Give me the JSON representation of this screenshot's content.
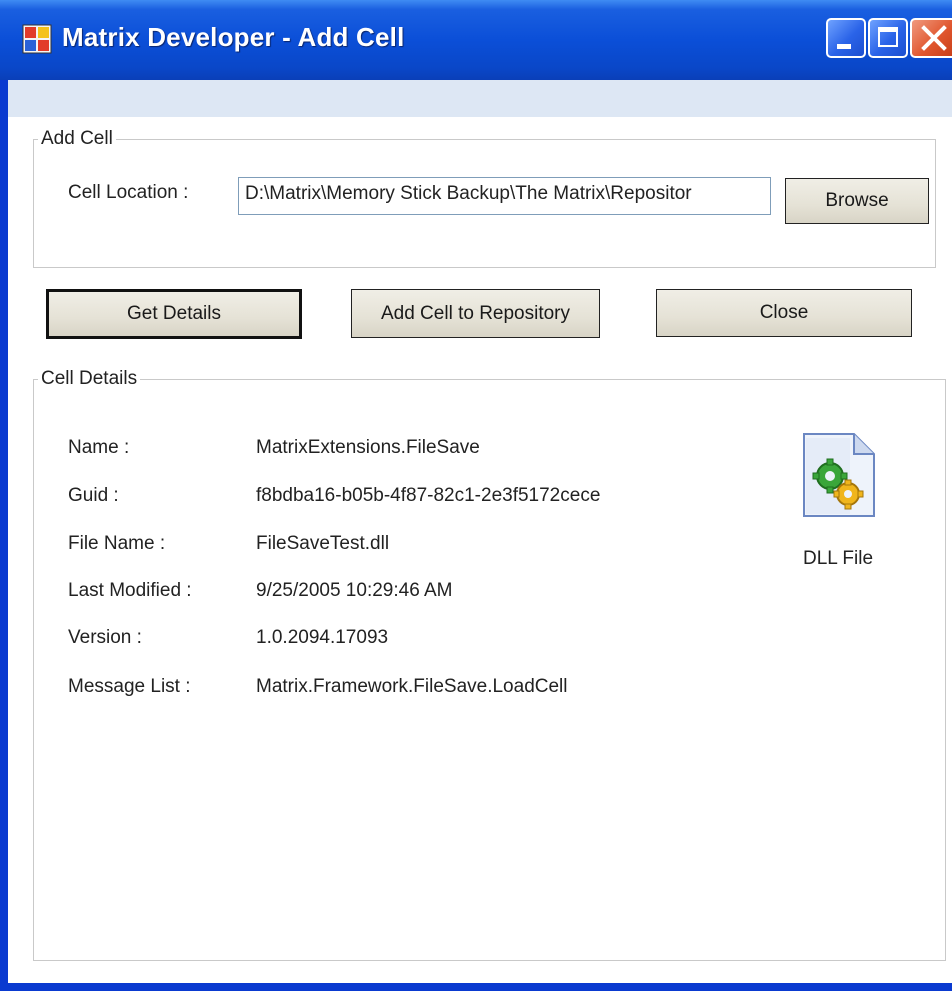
{
  "window": {
    "title": "Matrix Developer - Add Cell"
  },
  "add_cell": {
    "group_label": "Add Cell",
    "location_label": "Cell Location :",
    "location_value": "D:\\Matrix\\Memory Stick Backup\\The Matrix\\Repositor",
    "browse_label": "Browse"
  },
  "actions": {
    "get_details_label": "Get Details",
    "add_to_repo_label": "Add Cell to Repository",
    "close_label": "Close"
  },
  "cell_details": {
    "group_label": "Cell Details",
    "fields": [
      {
        "label": "Name :",
        "value": "MatrixExtensions.FileSave"
      },
      {
        "label": "Guid :",
        "value": "f8bdba16-b05b-4f87-82c1-2e3f5172cece"
      },
      {
        "label": "File Name :",
        "value": "FileSaveTest.dll"
      },
      {
        "label": "Last Modified :",
        "value": "9/25/2005 10:29:46 AM"
      },
      {
        "label": "Version :",
        "value": "1.0.2094.17093"
      },
      {
        "label": "Message List :",
        "value": "Matrix.Framework.FileSave.LoadCell"
      }
    ],
    "file_icon": "dll-file-icon",
    "file_type_label": "DLL File"
  },
  "colors": {
    "titlebar": "#0b4fd8",
    "close_button": "#e0562e",
    "toolbar_strip": "#dde7f4",
    "button_face": "#e5e2d6"
  }
}
